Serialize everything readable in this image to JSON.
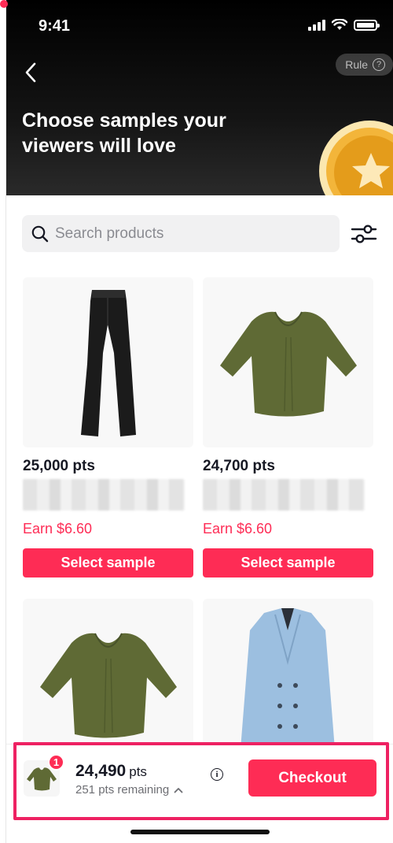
{
  "status_bar": {
    "time": "9:41"
  },
  "header": {
    "title": "Choose samples your viewers will love",
    "rule_label": "Rule",
    "rule_icon": "question-circle-icon",
    "back_icon": "chevron-left-icon"
  },
  "search": {
    "placeholder": "Search products",
    "value": ""
  },
  "products": [
    {
      "points": "25,000 pts",
      "earn": "Earn $6.60",
      "button": "Select sample",
      "image": "black-trousers"
    },
    {
      "points": "24,700 pts",
      "earn": "Earn $6.60",
      "button": "Select sample",
      "image": "olive-ruched-top"
    },
    {
      "image": "olive-ruched-top"
    },
    {
      "image": "blue-double-breasted-blazer"
    }
  ],
  "cart": {
    "badge_count": "1",
    "total_points": "24,490",
    "unit": "pts",
    "remaining": "251 pts remaining",
    "checkout_label": "Checkout"
  },
  "colors": {
    "accent": "#fe2c55",
    "highlight": "#ee2162",
    "header_bg": "#000000"
  }
}
